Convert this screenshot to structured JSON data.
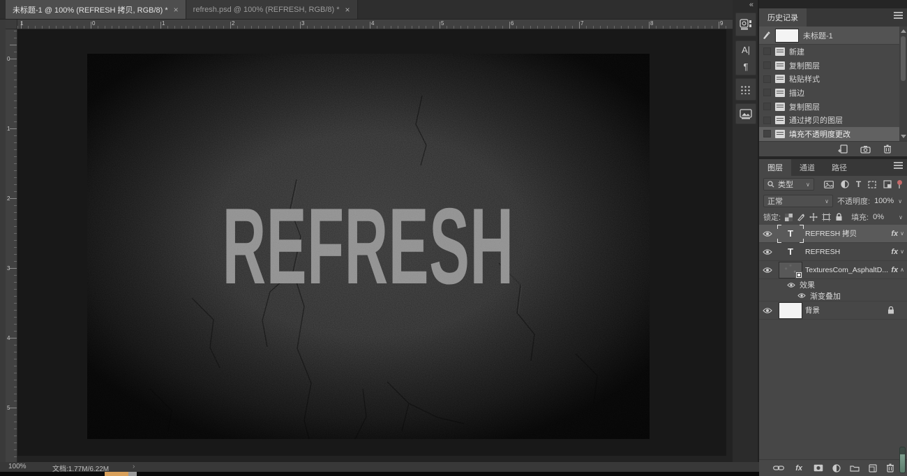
{
  "glyphs": {
    "close": "×",
    "collapse": "«",
    "chevron_down": "∨",
    "chevron_up": "∧",
    "status_arrow": "›",
    "character_icon": "A|",
    "paragraph_icon": "¶",
    "text_icon": "T"
  },
  "tabs": [
    {
      "title": "未标题-1 @ 100% (REFRESH 拷贝, RGB/8) *"
    },
    {
      "title": "refresh.psd @ 100% (REFRESH, RGB/8) *"
    }
  ],
  "rulers": {
    "top": [
      "1",
      "0",
      "1",
      "2",
      "3",
      "4",
      "5",
      "6",
      "7",
      "8",
      "9"
    ],
    "left": [
      "0",
      "1",
      "2",
      "3",
      "4",
      "5"
    ]
  },
  "canvas": {
    "text": "REFRESH"
  },
  "history": {
    "title": "历史记录",
    "snapshot": "未标题-1",
    "items": [
      "新建",
      "复制图层",
      "粘贴样式",
      "描边",
      "复制图层",
      "通过拷贝的图层",
      "填充不透明度更改"
    ]
  },
  "layers": {
    "tab_layers": "图层",
    "tab_channels": "通道",
    "tab_paths": "路径",
    "filter_label": "类型",
    "blend_mode": "正常",
    "opacity_label": "不透明度:",
    "opacity_value": "100%",
    "lock_label": "锁定:",
    "fill_label": "填充:",
    "fill_value": "0%",
    "fx_label": "fx",
    "rows": [
      {
        "name": "REFRESH 拷贝"
      },
      {
        "name": "REFRESH"
      },
      {
        "name": "TexturesCom_AsphaltD..."
      },
      {
        "name": "背景"
      }
    ],
    "effects_label": "效果",
    "effect_name": "渐变叠加"
  },
  "status": {
    "zoom": "100%",
    "doc": "文档:1.77M/6.22M"
  },
  "colors": {
    "selection": "#5a5a5a",
    "filter_toggle": "#c46a6a",
    "canvas_text": "#8e8e8e"
  }
}
